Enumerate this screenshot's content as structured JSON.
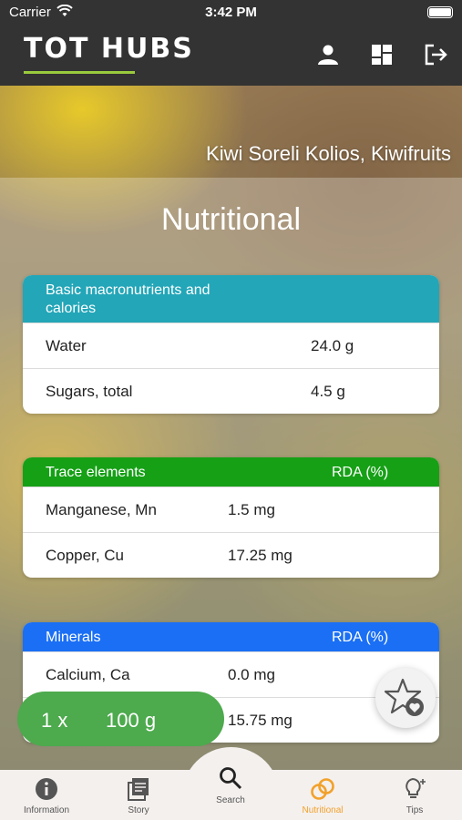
{
  "status_bar": {
    "carrier": "Carrier",
    "time": "3:42 PM"
  },
  "nav": {
    "logo_text": "TOT HUBS",
    "icons": [
      "user-icon",
      "dashboard-icon",
      "logout-icon"
    ]
  },
  "banner": {
    "title": "Kiwi Soreli Kolios, Kiwifruits"
  },
  "section_title": "Nutritional",
  "cards": {
    "macros": {
      "title": "Basic macronutrients and calories",
      "title_line1": "Basic macronutrients and",
      "title_line2": "calories",
      "color": "#23a6b8",
      "rows": [
        {
          "name": "Water",
          "value": "24.0 g"
        },
        {
          "name": "Sugars, total",
          "value": "4.5 g"
        }
      ]
    },
    "trace": {
      "title": "Trace elements",
      "rda_label": "RDA (%)",
      "color": "#16a016",
      "rows": [
        {
          "name": "Manganese, Mn",
          "value": "1.5 mg"
        },
        {
          "name": "Copper, Cu",
          "value": "17.25 mg"
        }
      ]
    },
    "minerals": {
      "title": "Minerals",
      "rda_label": "RDA (%)",
      "color": "#1a6ff5",
      "rows": [
        {
          "name": "Calcium, Ca",
          "value": "0.0 mg"
        },
        {
          "name": "",
          "value": "15.75 mg"
        }
      ]
    }
  },
  "quantity": {
    "multiplier": "1 x",
    "amount": "100 g",
    "color": "#4daa4d"
  },
  "favorite": {
    "icon": "star-heart-icon"
  },
  "tabs": [
    {
      "label": "Information",
      "icon": "info-icon",
      "active": false
    },
    {
      "label": "Story",
      "icon": "book-icon",
      "active": false
    },
    {
      "label": "Search",
      "icon": "search-icon",
      "active": false
    },
    {
      "label": "Nutritional",
      "icon": "rings-icon",
      "active": true
    },
    {
      "label": "Tips",
      "icon": "lightbulb-icon",
      "active": false
    }
  ],
  "colors": {
    "bar": "#333333",
    "active_tab": "#f2a12a",
    "tabbar": "#f4f0ee"
  }
}
